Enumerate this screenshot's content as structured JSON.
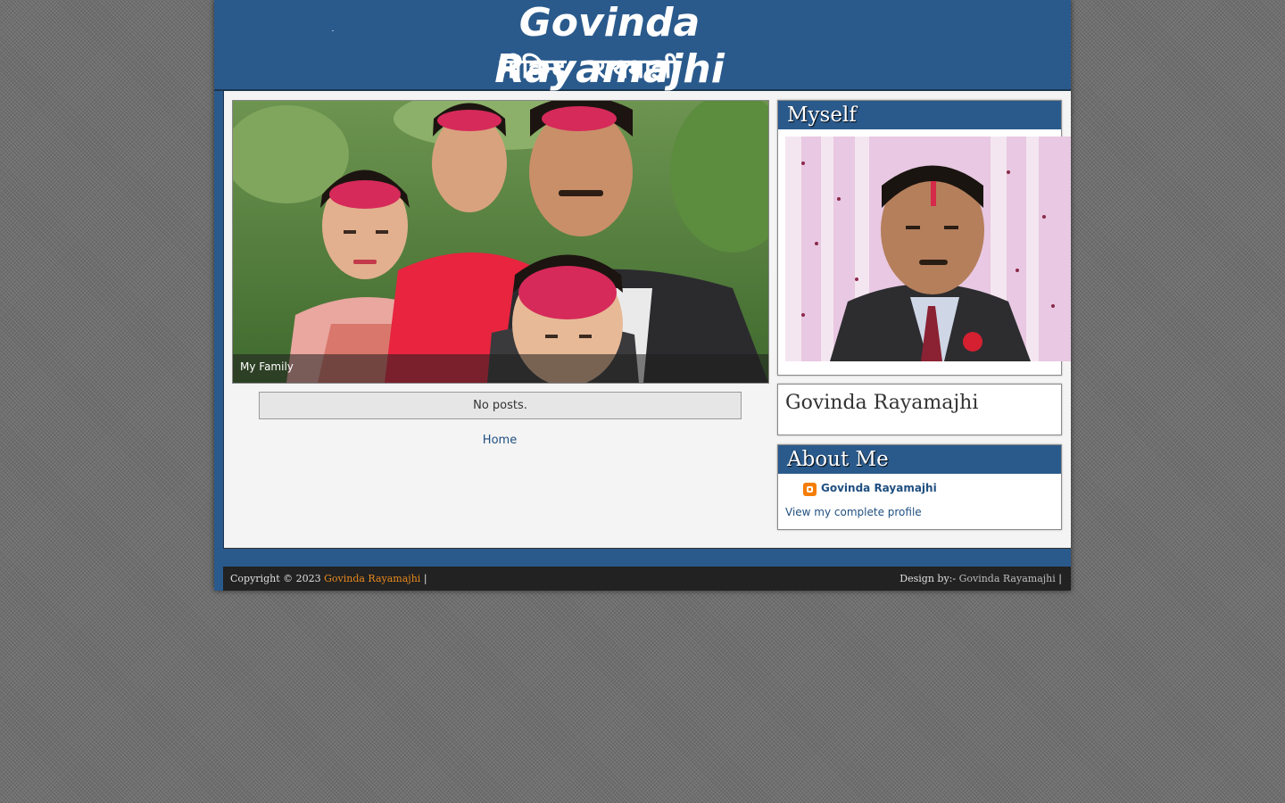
{
  "header": {
    "title": "Govinda Rayamajhi",
    "subtitle": "गोविन्द रायमाझी"
  },
  "slideshow": {
    "caption": "My Family"
  },
  "posts": {
    "empty_message": "No posts.",
    "home_link": "Home"
  },
  "sidebar": {
    "myself_title": "Myself",
    "name_widget_text": "Govinda Rayamajhi",
    "about_title": "About Me",
    "profile_name": "Govinda Rayamajhi",
    "profile_link": "View my complete profile"
  },
  "footer": {
    "copyright_prefix": "Copyright © 2023",
    "copyright_link": "Govinda Rayamajhi",
    "sep": "|",
    "design_prefix": "Design by:-",
    "design_link": "Govinda Rayamajhi"
  },
  "colors": {
    "header_blue": "#2a5a8c",
    "footer_dark": "#222222",
    "footer_link_orange": "#e8891e",
    "link_blue": "#1f4f80"
  }
}
